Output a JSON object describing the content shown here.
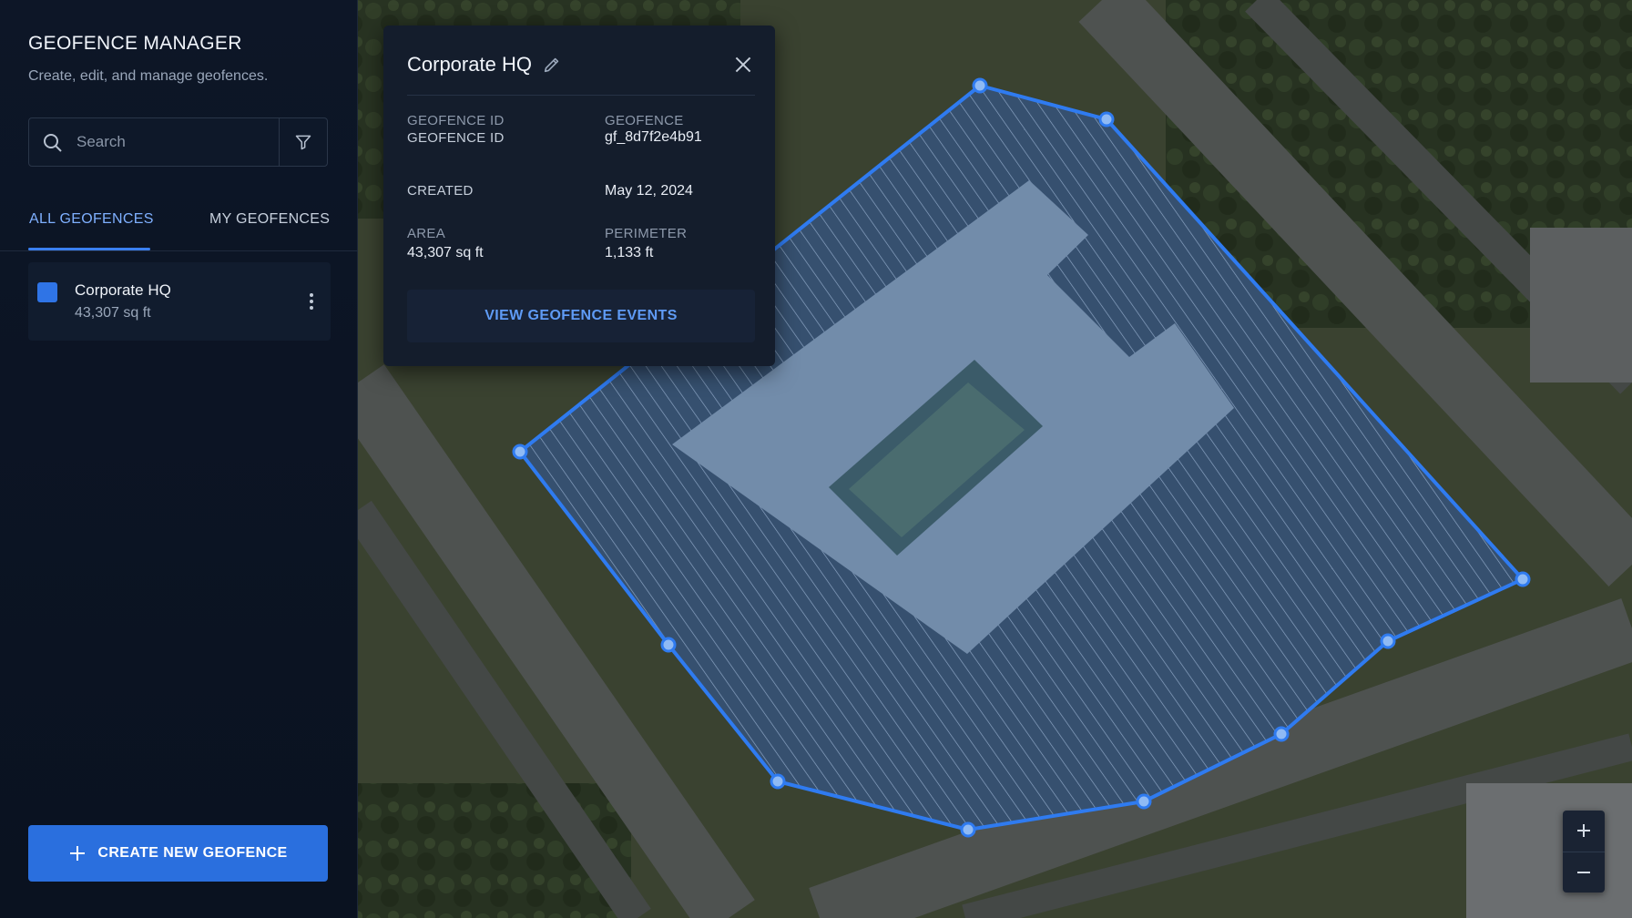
{
  "sidebar": {
    "title": "GEOFENCE MANAGER",
    "subtitle": "Create, edit, and manage geofences.",
    "search": {
      "placeholder": "Search",
      "value": ""
    },
    "tabs": [
      {
        "label": "ALL GEOFENCES",
        "active": true
      },
      {
        "label": "MY GEOFENCES",
        "active": false
      }
    ],
    "items": [
      {
        "name": "Corporate HQ",
        "area": "43,307 sq ft",
        "color": "#2f74e6"
      }
    ],
    "create_button": "CREATE NEW GEOFENCE"
  },
  "popup": {
    "title": "Corporate HQ",
    "fields": {
      "geofence_id_label": "GEOFENCE ID",
      "geofence_id_label_echo": "GEOFENCE ID",
      "geofence_label_right": "GEOFENCE",
      "geofence_id_value": "gf_8d7f2e4b91",
      "created_label": "CREATED",
      "created_value": "May 12, 2024",
      "area_label": "AREA",
      "area_value": "43,307 sq ft",
      "perimeter_label": "PERIMETER",
      "perimeter_value": "1,133 ft"
    },
    "events_button": "VIEW GEOFENCE EVENTS"
  },
  "map": {
    "polygon_stroke": "#2f7bf0",
    "polygon_fill": "#3a7fd8",
    "zoom_in": "+",
    "zoom_out": "−"
  }
}
